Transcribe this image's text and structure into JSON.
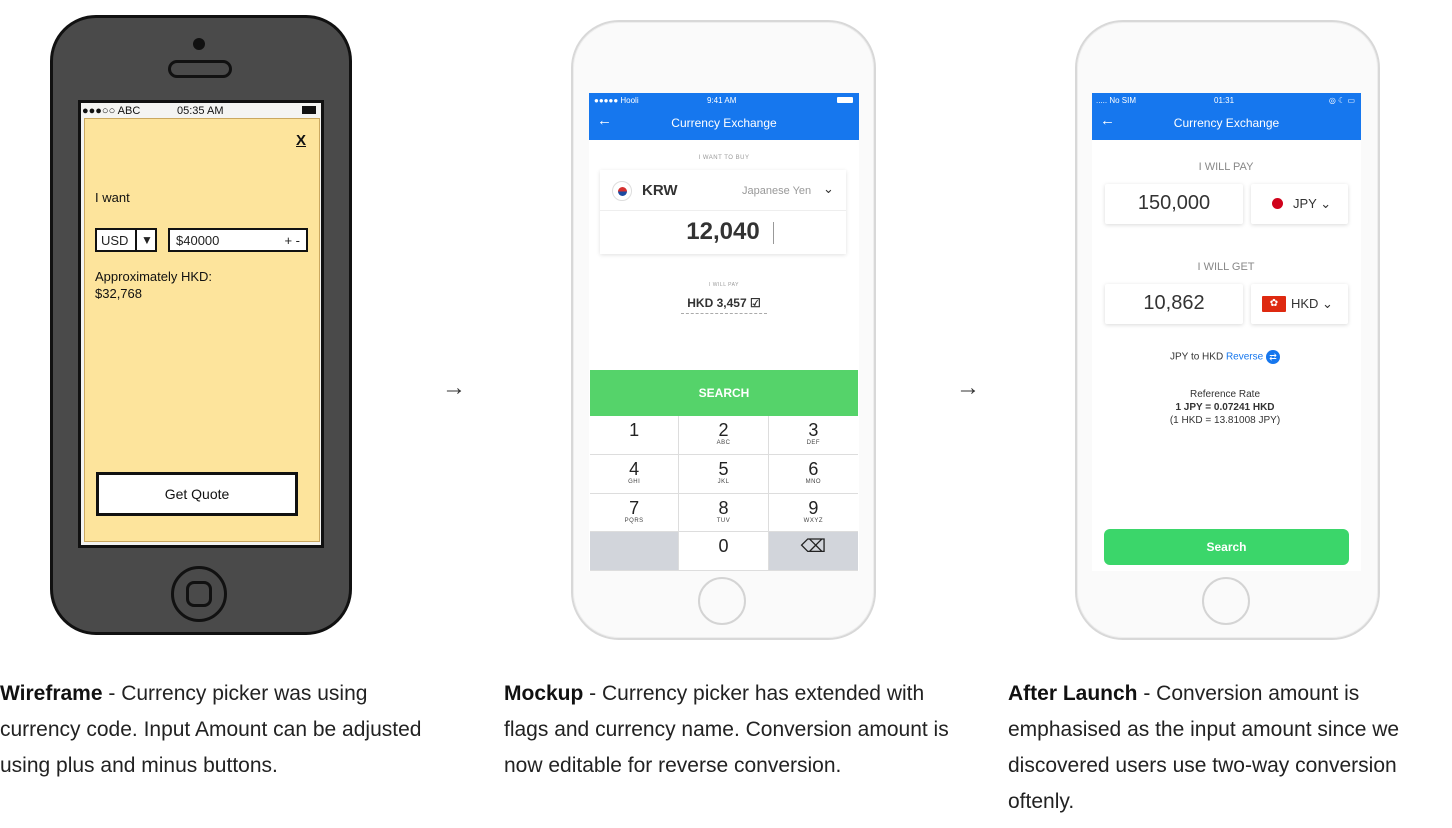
{
  "wireframe": {
    "status_left": "●●●○○ ABC",
    "status_time": "05:35 AM",
    "close": "X",
    "i_want": "I want",
    "currency_code": "USD",
    "dropdown_arrow": "▼",
    "amount_value": "$40000",
    "plus_minus": "+  -",
    "approx_label": "Approximately HKD:",
    "approx_value": "$32,768",
    "quote_button": "Get Quote"
  },
  "arrows": {
    "glyph": "→"
  },
  "mockup": {
    "status_left": "●●●●● Hooli",
    "status_time": "9:41 AM",
    "back": "←",
    "title": "Currency Exchange",
    "want_label": "I WANT TO BUY",
    "currency_code": "KRW",
    "currency_name": "Japanese Yen",
    "chevron": "⌄",
    "amount": "12,040",
    "pay_label": "I WILL PAY",
    "pay_value": "HKD  3,457  ☑",
    "search_label": "SEARCH",
    "keys": [
      {
        "n": "1",
        "s": ""
      },
      {
        "n": "2",
        "s": "ABC"
      },
      {
        "n": "3",
        "s": "DEF"
      },
      {
        "n": "4",
        "s": "GHI"
      },
      {
        "n": "5",
        "s": "JKL"
      },
      {
        "n": "6",
        "s": "MNO"
      },
      {
        "n": "7",
        "s": "PQRS"
      },
      {
        "n": "8",
        "s": "TUV"
      },
      {
        "n": "9",
        "s": "WXYZ"
      },
      {
        "n": "",
        "s": ""
      },
      {
        "n": "0",
        "s": ""
      },
      {
        "n": "⌫",
        "s": ""
      }
    ]
  },
  "after_launch": {
    "status_left": "..... No SIM",
    "status_time": "01:31",
    "status_right": "◎ ☾ ▭",
    "back": "←",
    "title": "Currency Exchange",
    "pay_label": "I WILL PAY",
    "pay_amount": "150,000",
    "pay_currency": "JPY ⌄",
    "get_label": "I WILL GET",
    "get_amount": "10,862",
    "get_currency": "HKD ⌄",
    "hk_flag_glyph": "✿",
    "reverse_prefix": "JPY to HKD",
    "reverse_link": "Reverse",
    "reverse_icon": "⇄",
    "rate_title": "Reference Rate",
    "rate_main": "1 JPY = 0.07241 HKD",
    "rate_inverse": "(1 HKD = 13.81008 JPY)",
    "search_label": "Search"
  },
  "captions": [
    {
      "title": "Wireframe",
      "text": " - Currency picker was using currency code.  Input Amount can be adjusted using plus and minus buttons."
    },
    {
      "title": "Mockup",
      "text": " - Currency picker has extended with flags and currency name. Conversion amount is now editable for reverse conversion."
    },
    {
      "title": "After Launch",
      "text": " - Conversion amount is emphasised as the input amount since we discovered users use two-way conversion oftenly."
    }
  ],
  "colors": {
    "wireframe_screen": "#fde49c",
    "app_blue": "#1677ee",
    "mockup_search_green": "#55d36a",
    "launch_search_green": "#3bd66a"
  }
}
